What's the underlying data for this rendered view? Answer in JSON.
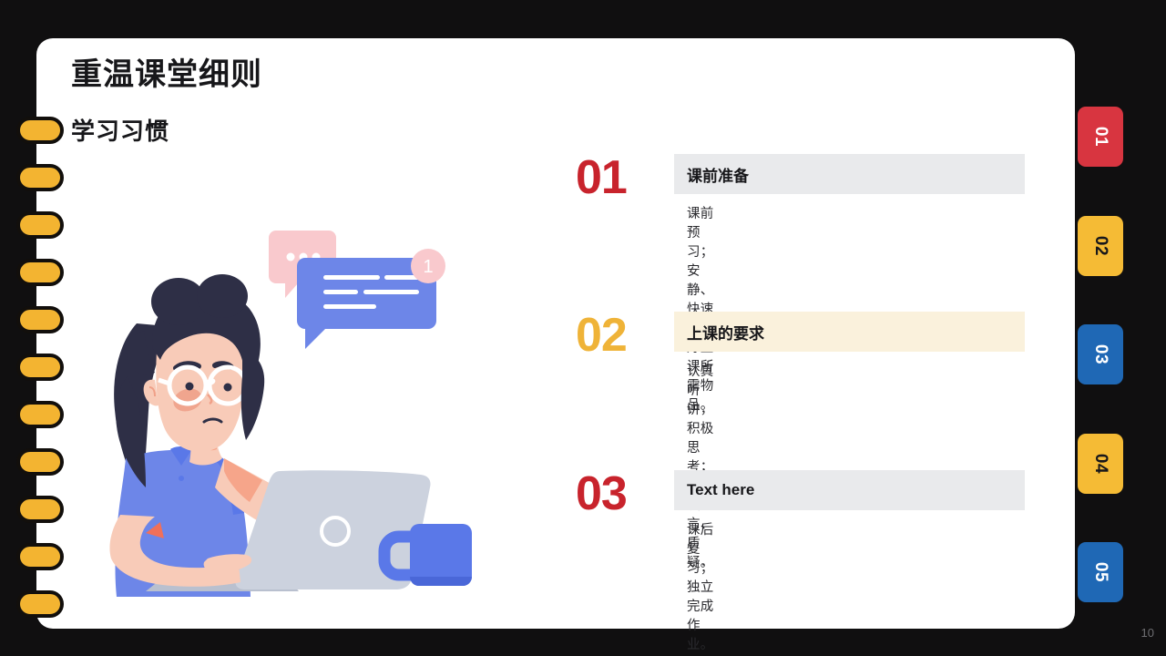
{
  "slide": {
    "title": "重温课堂细则",
    "subtitle": "学习习惯",
    "page_number": "10",
    "background_color": "#100f10",
    "card_color": "#ffffff"
  },
  "ring_binding": {
    "icon": "spiral-ring",
    "count": 11,
    "color": "#f3b431",
    "outline_color": "#120f0c"
  },
  "items": [
    {
      "number": "01",
      "number_color": "#c8232c",
      "heading": "课前准备",
      "heading_bg": "#e9eaec",
      "description": "课前预习；安静、快速准备好上课所需物品。"
    },
    {
      "number": "02",
      "number_color": "#efb338",
      "heading": "上课的要求",
      "heading_bg": "#faf1dc",
      "description": "认真听讲，积极思考；大胆发言、质疑。"
    },
    {
      "number": "03",
      "number_color": "#c8232c",
      "heading": "Text here",
      "heading_bg": "#e9eaec",
      "description": "课后复习；独立完成作业。"
    }
  ],
  "side_tabs": [
    {
      "label": "01",
      "bg": "#d83540",
      "fg": "#ffffff"
    },
    {
      "label": "02",
      "bg": "#f5bb35",
      "fg": "#17171a"
    },
    {
      "label": "03",
      "bg": "#1f68b5",
      "fg": "#ffffff"
    },
    {
      "label": "04",
      "bg": "#f5bb35",
      "fg": "#17171a"
    },
    {
      "label": "05",
      "bg": "#1f68b5",
      "fg": "#ffffff"
    }
  ],
  "illustration": {
    "name": "woman-at-laptop-illustration",
    "elements": [
      "woman-character",
      "hair",
      "glasses",
      "blue-shirt",
      "pointing-hand",
      "laptop",
      "coffee-mug",
      "pink-chat-bubble",
      "blue-chat-bubble",
      "notification-badge"
    ],
    "notification_badge_text": "1",
    "colors": {
      "hair": "#2e2f46",
      "skin": "#f5c0aa",
      "shirt": "#6d86e8",
      "laptop": "#ccd2de",
      "mug": "#5a78e8",
      "bubble_pink": "#f9c9cd",
      "bubble_blue": "#6d86e8"
    }
  }
}
